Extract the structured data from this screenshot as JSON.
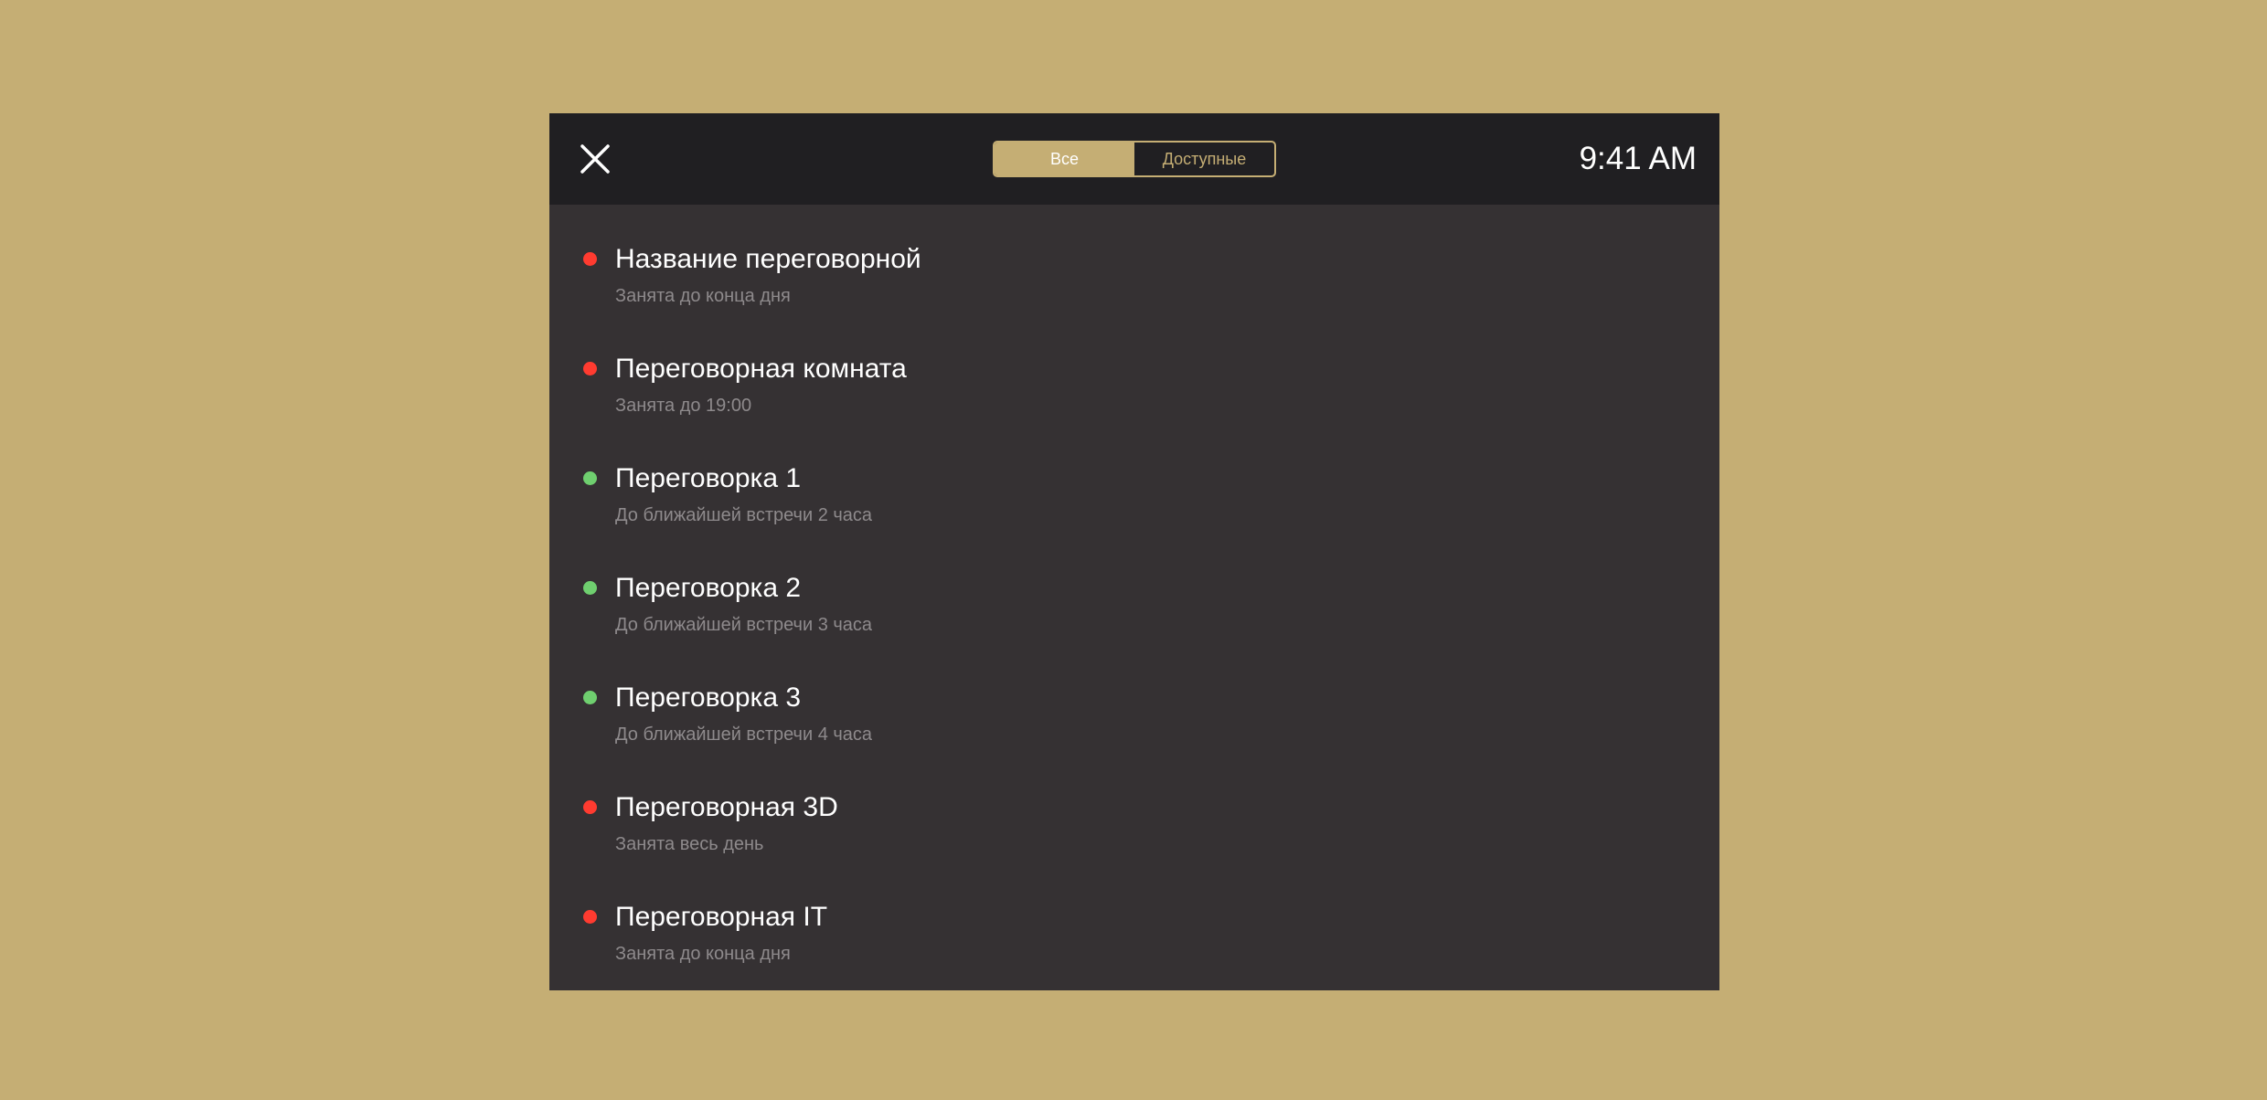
{
  "colors": {
    "background": "#c5ae74",
    "panel": "#353133",
    "topbar": "#201f22",
    "accent": "#c5ae74",
    "busy": "#ff3b30",
    "free": "#6fcf6f",
    "secondary_text": "#8e8a8c"
  },
  "header": {
    "close_icon": "close-icon",
    "filter": {
      "all_label": "Все",
      "available_label": "Доступные",
      "selected": "Все"
    },
    "clock": "9:41 AM"
  },
  "rooms": [
    {
      "name": "Название переговорной",
      "status": "Занята до конца дня",
      "state": "busy"
    },
    {
      "name": "Переговорная комната",
      "status": "Занята до 19:00",
      "state": "busy"
    },
    {
      "name": "Переговорка 1",
      "status": "До ближайшей встречи 2 часа",
      "state": "free"
    },
    {
      "name": "Переговорка 2",
      "status": "До ближайшей встречи 3 часа",
      "state": "free"
    },
    {
      "name": "Переговорка 3",
      "status": "До ближайшей встречи 4 часа",
      "state": "free"
    },
    {
      "name": "Переговорная 3D",
      "status": "Занята весь день",
      "state": "busy"
    },
    {
      "name": "Переговорная IT",
      "status": "Занята до конца дня",
      "state": "busy"
    }
  ]
}
